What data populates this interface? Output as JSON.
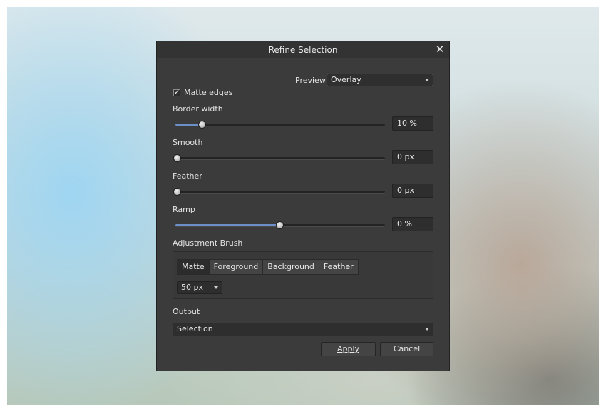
{
  "dialog": {
    "title": "Refine Selection",
    "close_glyph": "✕",
    "preview": {
      "label": "Preview",
      "value": "Overlay"
    },
    "matte_edges": {
      "label": "Matte edges",
      "checked": true,
      "check_glyph": "✓"
    },
    "sliders": [
      {
        "label": "Border width",
        "value": "10 %",
        "fraction": 0.12
      },
      {
        "label": "Smooth",
        "value": "0 px",
        "fraction": 0
      },
      {
        "label": "Feather",
        "value": "0 px",
        "fraction": 0
      },
      {
        "label": "Ramp",
        "value": "0 %",
        "fraction": 0.49
      }
    ],
    "adjustment_brush": {
      "label": "Adjustment Brush",
      "modes": [
        "Matte",
        "Foreground",
        "Background",
        "Feather"
      ],
      "active_mode": "Matte",
      "size_value": "50 px"
    },
    "output": {
      "label": "Output",
      "value": "Selection"
    },
    "buttons": {
      "apply": "Apply",
      "cancel": "Cancel"
    }
  }
}
